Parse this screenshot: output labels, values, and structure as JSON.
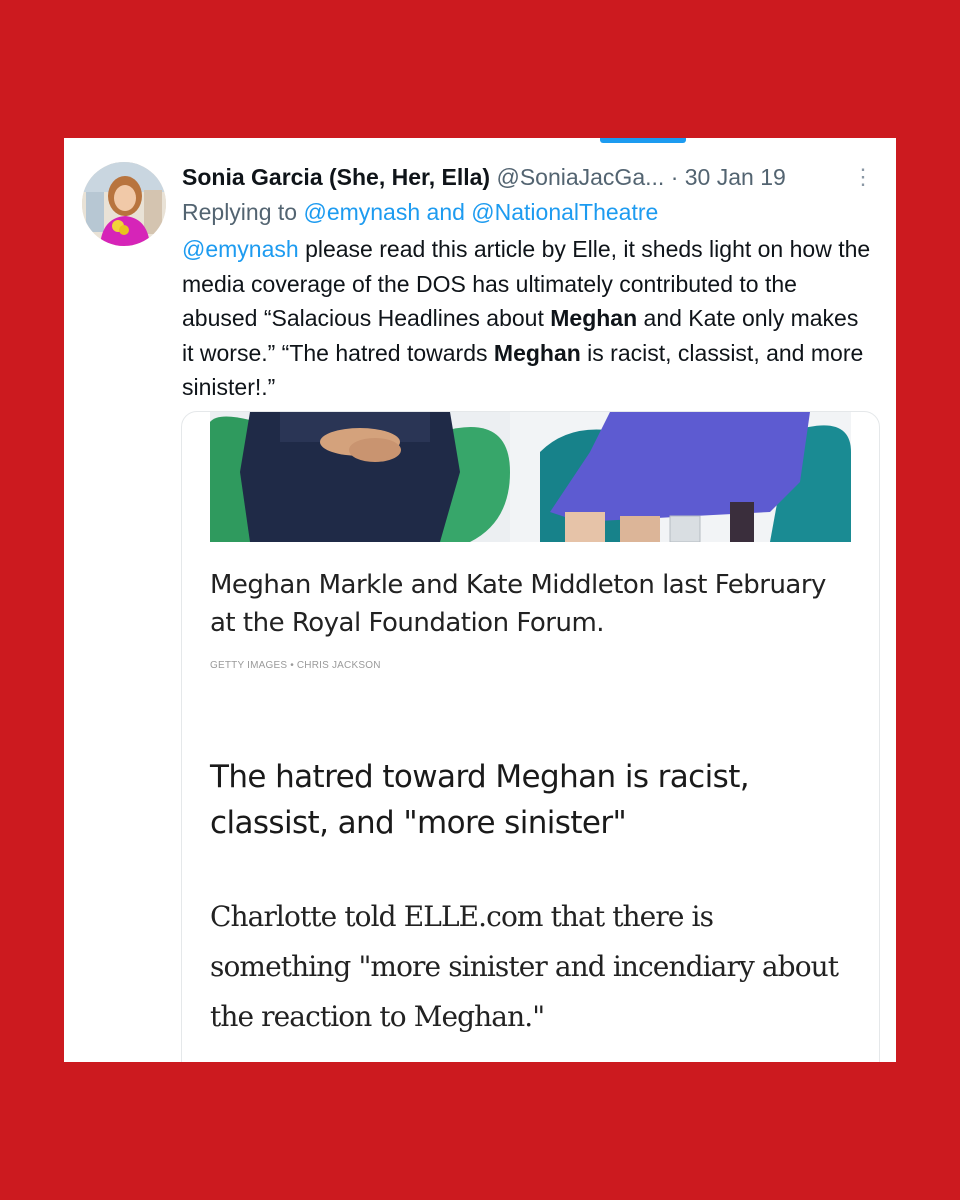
{
  "tweet": {
    "author_name": "Sonia Garcia (She, Her, Ella)",
    "handle": "@SoniaJacGa...",
    "separator": "·",
    "date": "30 Jan 19",
    "more_icon": "more-vertical-icon",
    "replying_prefix": "Replying to ",
    "replying_links": "@emynash and @NationalTheatre",
    "text": {
      "mention": "@emynash",
      "part1": " please read this article by Elle, it sheds light on how the media coverage of the DOS has ultimately contributed to the abused “Salacious Headlines about ",
      "bold1": "Meghan",
      "part2": " and Kate only makes it worse.” “The hatred towards ",
      "bold2": "Meghan",
      "part3": " is racist, classist, and more sinister!.”"
    }
  },
  "embed": {
    "caption": "Meghan Markle and Kate Middleton last February at the Royal Foundation Forum.",
    "credit": "GETTY IMAGES • CHRIS JACKSON",
    "headline": "The hatred toward Meghan is racist, classist, and \"more sinister\"",
    "body": "Charlotte told ELLE.com that there is something \"more sinister and incendiary about the reaction to Meghan.\""
  },
  "colors": {
    "background": "#cc1a1f",
    "link": "#1d9bf0",
    "secondary_text": "#536471"
  }
}
